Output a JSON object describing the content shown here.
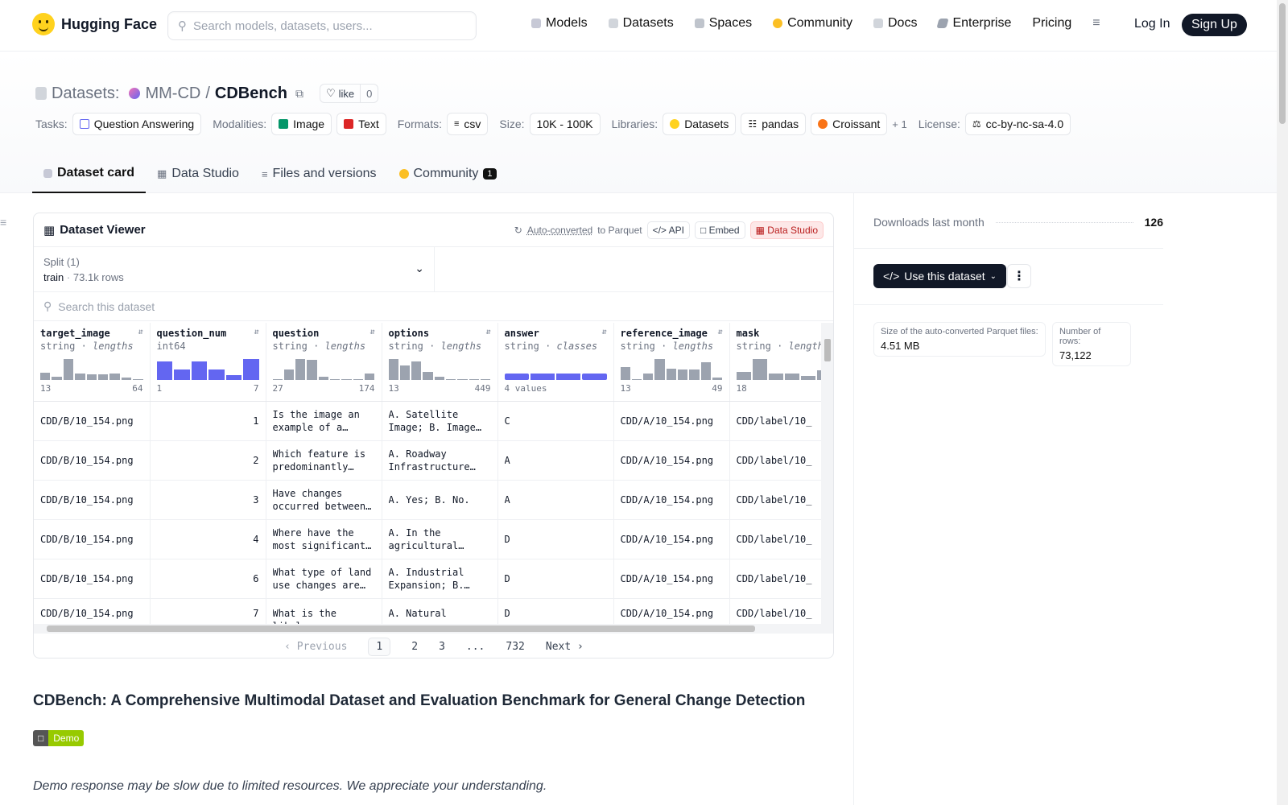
{
  "nav": {
    "brand": "Hugging Face",
    "search_placeholder": "Search models, datasets, users...",
    "links": [
      "Models",
      "Datasets",
      "Spaces",
      "Community",
      "Docs",
      "Enterprise",
      "Pricing"
    ],
    "login": "Log In",
    "signup": "Sign Up"
  },
  "repo": {
    "prefix": "Datasets:",
    "owner": "MM-CD",
    "name": "CDBench",
    "like": "like",
    "likes": "0"
  },
  "tags": {
    "tasks_label": "Tasks:",
    "task": "Question Answering",
    "modalities_label": "Modalities:",
    "mod1": "Image",
    "mod2": "Text",
    "formats_label": "Formats:",
    "format": "csv",
    "size_label": "Size:",
    "size": "10K - 100K",
    "libraries_label": "Libraries:",
    "lib1": "Datasets",
    "lib2": "pandas",
    "lib3": "Croissant",
    "more": "+ 1",
    "license_label": "License:",
    "license": "cc-by-nc-sa-4.0"
  },
  "tabs": {
    "card": "Dataset card",
    "studio": "Data Studio",
    "files": "Files and versions",
    "community": "Community",
    "community_count": "1"
  },
  "viewer": {
    "title": "Dataset Viewer",
    "autoconv": "Auto-converted",
    "to_parquet": "to Parquet",
    "api": "API",
    "embed": "Embed",
    "studio": "Data Studio",
    "split_label": "Split (1)",
    "split_name": "train",
    "split_rows": "73.1k rows",
    "search_placeholder": "Search this dataset",
    "columns": [
      {
        "name": "target_image",
        "type": "string",
        "stat": "lengths",
        "min": "13",
        "max": "64",
        "hist": [
          0.35,
          0.15,
          1,
          0.3,
          0.28,
          0.28,
          0.3,
          0.1,
          0.05
        ],
        "blue": false
      },
      {
        "name": "question_num",
        "type": "int64",
        "stat": "",
        "min": "1",
        "max": "7",
        "hist": [
          0.9,
          0.5,
          0.9,
          0.5,
          0.25,
          1
        ],
        "blue": true
      },
      {
        "name": "question",
        "type": "string",
        "stat": "lengths",
        "min": "27",
        "max": "174",
        "hist": [
          0.05,
          0.5,
          1,
          0.95,
          0.15,
          0.05,
          0.05,
          0.05,
          0.3
        ],
        "blue": false
      },
      {
        "name": "options",
        "type": "string",
        "stat": "lengths",
        "min": "13",
        "max": "449",
        "hist": [
          1,
          0.7,
          0.9,
          0.4,
          0.15,
          0.05,
          0.05,
          0.05,
          0.03
        ],
        "blue": false
      },
      {
        "name": "answer",
        "type": "string",
        "stat": "classes",
        "min": "4 values",
        "max": "",
        "hist": [],
        "blue": true
      },
      {
        "name": "reference_image",
        "type": "string",
        "stat": "lengths",
        "min": "13",
        "max": "49",
        "hist": [
          0.6,
          0.05,
          0.3,
          1,
          0.55,
          0.5,
          0.5,
          0.85,
          0.1
        ],
        "blue": false
      },
      {
        "name": "mask",
        "type": "string",
        "stat": "lengths",
        "min": "18",
        "max": "",
        "hist": [
          0.4,
          1,
          0.3,
          0.3,
          0.2,
          0.45,
          0.35
        ],
        "blue": false
      }
    ],
    "rows": [
      [
        "CDD/B/10_154.png",
        "1",
        "Is the image an example of a…",
        "A. Satellite Image; B. Image o…",
        "C",
        "CDD/A/10_154.png",
        "CDD/label/10_"
      ],
      [
        "CDD/B/10_154.png",
        "2",
        "Which feature is predominantly…",
        "A. Roadway Infrastructure an…",
        "A",
        "CDD/A/10_154.png",
        "CDD/label/10_"
      ],
      [
        "CDD/B/10_154.png",
        "3",
        "Have changes occurred between…",
        "A. Yes; B. No.",
        "A",
        "CDD/A/10_154.png",
        "CDD/label/10_"
      ],
      [
        "CDD/B/10_154.png",
        "4",
        "Where have the most significant…",
        "A. In the agricultural…",
        "D",
        "CDD/A/10_154.png",
        "CDD/label/10_"
      ],
      [
        "CDD/B/10_154.png",
        "6",
        "What type of land use changes are…",
        "A. Industrial Expansion; B.…",
        "D",
        "CDD/A/10_154.png",
        "CDD/label/10_"
      ],
      [
        "CDD/B/10_154.png",
        "7",
        "What is the likely",
        "A. Natural",
        "D",
        "CDD/A/10_154.png",
        "CDD/label/10_"
      ]
    ],
    "pager": {
      "prev": "Previous",
      "pages": [
        "1",
        "2",
        "3",
        "...",
        "732"
      ],
      "next": "Next"
    }
  },
  "readme": {
    "title": "CDBench: A Comprehensive Multimodal Dataset and Evaluation Benchmark for General Change Detection",
    "demo_left": "Demo",
    "note": "Demo response may be slow due to limited resources. We appreciate your understanding."
  },
  "sidebar": {
    "downloads_label": "Downloads last month",
    "downloads": "126",
    "use_dataset": "Use this dataset",
    "parquet_label": "Size of the auto-converted Parquet files:",
    "parquet_size": "4.51 MB",
    "rows_label": "Number of rows:",
    "rows": "73,122"
  },
  "colors": {
    "accent": "#6366f1",
    "brand": "#ffd21e",
    "dark": "#111827"
  }
}
